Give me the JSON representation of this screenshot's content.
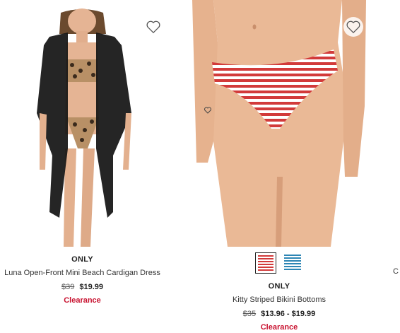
{
  "colors": {
    "clearance": "#c8102e",
    "heart_outline": "#555555",
    "selected_border": "#222222"
  },
  "products": [
    {
      "brand": "ONLY",
      "title": "Luna Open-Front Mini Beach Cardigan Dress",
      "price_original": "$39",
      "price_sale": "$19.99",
      "badge": "Clearance",
      "wishlist_icon": "heart-outline-icon",
      "swatches": []
    },
    {
      "brand": "ONLY",
      "title": "Kitty Striped Bikini Bottoms",
      "price_original": "$35",
      "price_sale": "$13.96 - $19.99",
      "badge": "Clearance",
      "wishlist_icon": "heart-outline-icon",
      "swatches": [
        {
          "name": "red-stripe",
          "color": "#d23a3a",
          "selected": true
        },
        {
          "name": "blue-stripe",
          "color": "#2d86b5",
          "selected": false
        }
      ]
    },
    {
      "title_fragment": "C"
    }
  ]
}
